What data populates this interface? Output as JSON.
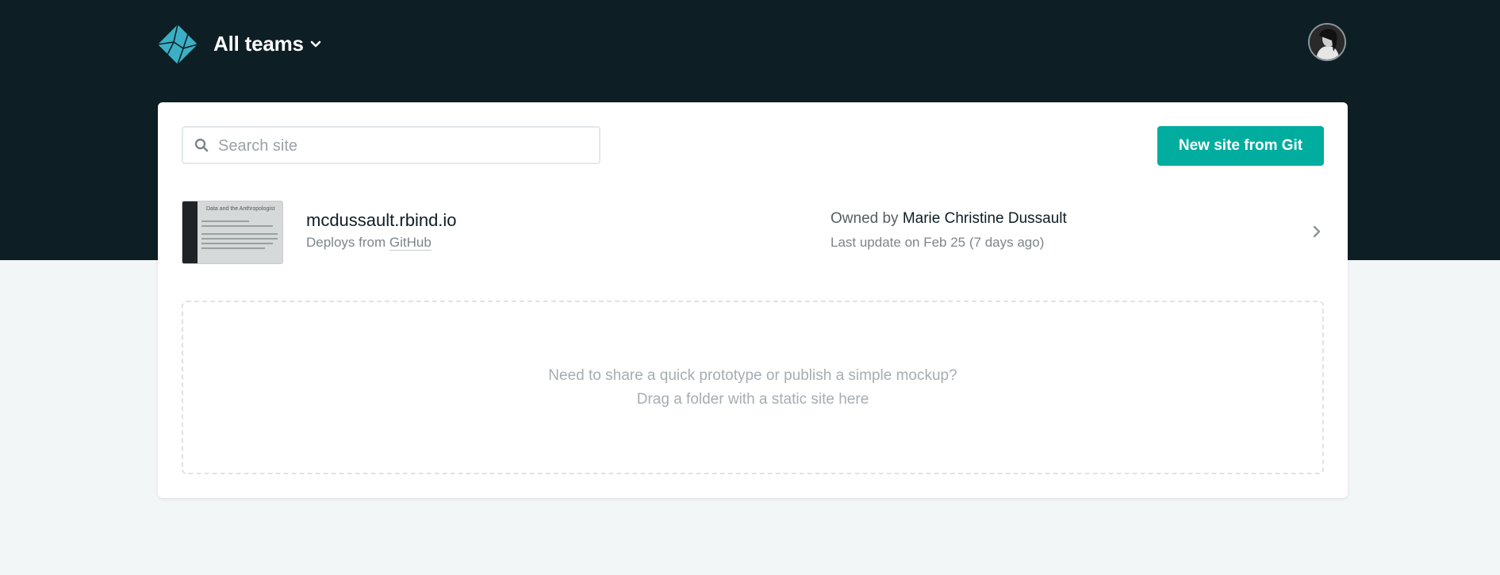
{
  "header": {
    "team_label": "All teams",
    "logo_icon": "netlify-logo-icon",
    "chevron_icon": "chevron-down-icon",
    "avatar_icon": "user-avatar"
  },
  "toolbar": {
    "search_placeholder": "Search site",
    "search_value": "",
    "new_site_label": "New site from Git"
  },
  "sites": [
    {
      "name": "mcdussault.rbind.io",
      "deploys_prefix": "Deploys from ",
      "deploys_provider": "GitHub",
      "owned_prefix": "Owned by ",
      "owner": "Marie Christine Dussault",
      "last_update": "Last update on Feb 25 (7 days ago)",
      "thumbnail_title": "Data and the Anthropologist"
    }
  ],
  "dropzone": {
    "line1": "Need to share a quick prototype or publish a simple mockup?",
    "line2": "Drag a folder with a static site here"
  },
  "colors": {
    "header_bg": "#0e1e25",
    "page_bg": "#f3f6f6",
    "accent": "#00ad9f",
    "logo": "#3bb0c4"
  }
}
